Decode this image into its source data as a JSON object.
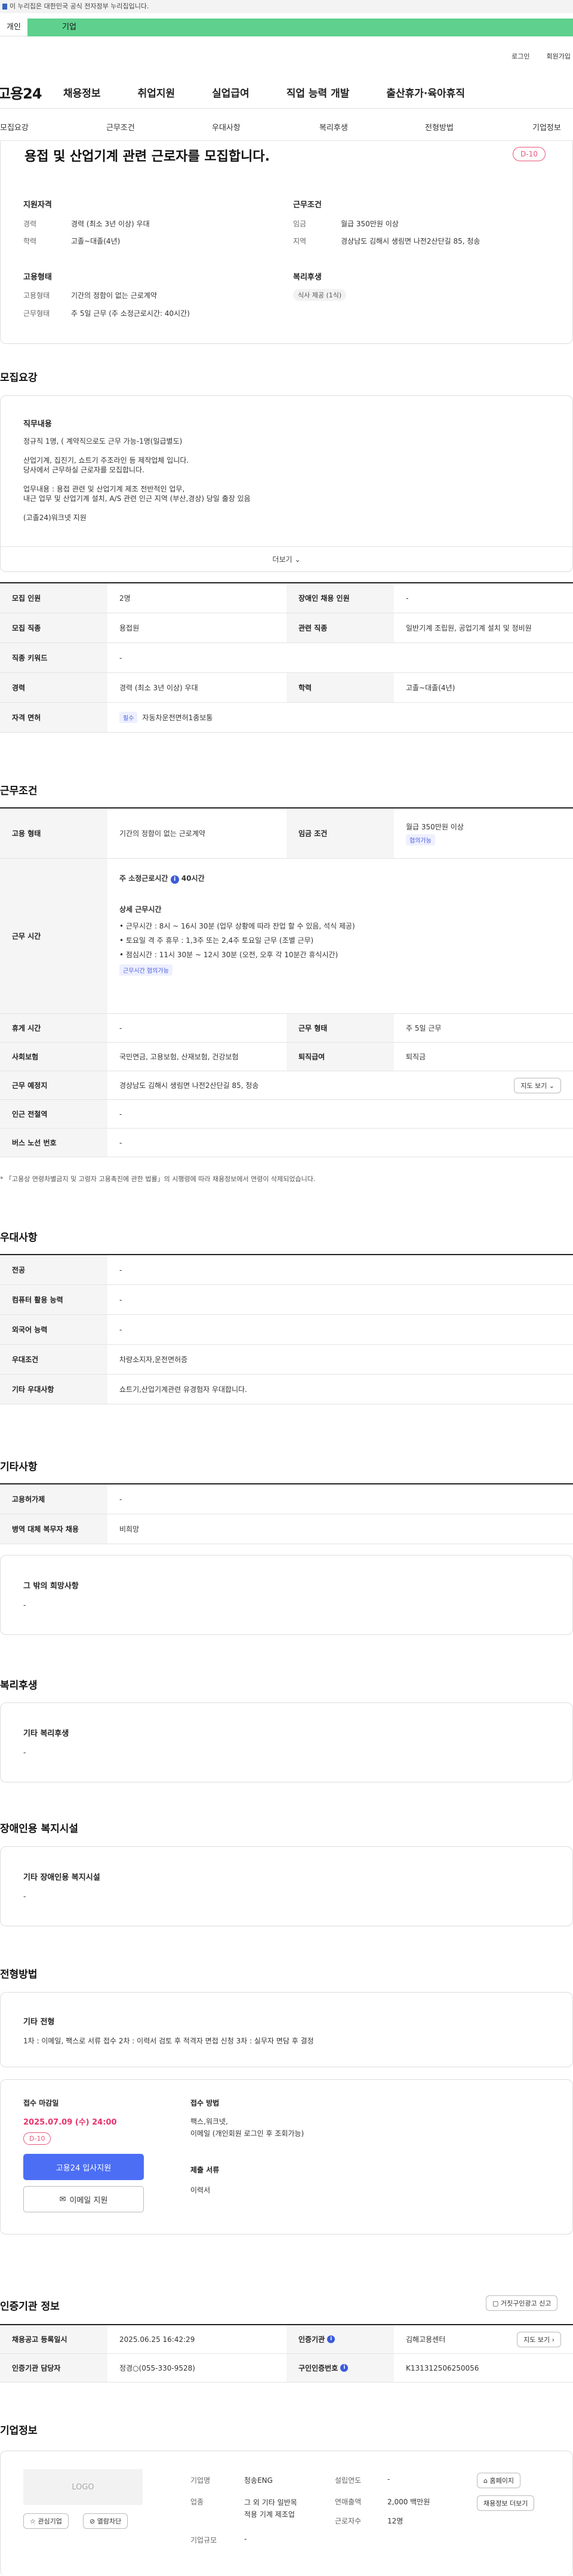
{
  "gov_bar": "이 누리집은 대한민국 공식 전자정부 누리집입니다.",
  "site_tabs": [
    "개인",
    "기업"
  ],
  "util_links": [
    "로그인",
    "회원가입"
  ],
  "logo": "고용24",
  "gnb": [
    "채용정보",
    "취업지원",
    "실업급여",
    "직업 능력 개발",
    "출산휴가·육아휴직"
  ],
  "subnav": [
    "모집요강",
    "근무조건",
    "우대사항",
    "복리후생",
    "전형방법",
    "기업정보"
  ],
  "summary": {
    "title": "용접 및 산업기계 관련 근로자를 모집합니다.",
    "dday": "D-10",
    "qual_title": "지원자격",
    "career_label": "경력",
    "career": "경력 (최소 3년 이상) 우대",
    "edu_label": "학력",
    "edu": "고졸~대졸(4년)",
    "cond_title": "근무조건",
    "wage_label": "임금",
    "wage": "월급 350만원 이상",
    "region_label": "지역",
    "region": "경상남도 김해시 생림면 나전2산단길 85, 청송",
    "emp_title": "고용형태",
    "emp_type_label": "고용형태",
    "emp_type": "기간의 정함이 없는 근로계약",
    "work_label": "근무형태",
    "work": "주 5일 근무 (주 소정근로시간: 40시간)",
    "welfare_title": "복리후생",
    "welfare_chip": "식사 제공 (1식)"
  },
  "recruit": {
    "heading": "모집요강",
    "duty_title": "직무내용",
    "duty_lines": [
      "정규직 1명, ( 계약직으로도 근무 가능-1명(일급별도)",
      "",
      "산업기계, 집진기, 쇼트기 주조라인 등 제작업체 입니다.",
      "당사에서 근무하실 근로자를 모집합니다.",
      "",
      "업무내용 : 용접 관련 및 산업기계 제조 전반적인 업무,",
      "내근 업무 및 산업기계 설치, A/S 관련 인근 지역 (부산,경상) 당일 출장 있음",
      "",
      "(고졸24)워크넷 지원"
    ],
    "more": "더보기",
    "rows": [
      [
        "모집 인원",
        "2명",
        "장애인 채용 인원",
        "-"
      ],
      [
        "모집 직종",
        "용접원",
        "관련 직종",
        "일반기계 조립원, 공업기계 설치 및 정비원"
      ],
      [
        "직종 키워드",
        "-"
      ],
      [
        "경력",
        "경력 (최소 3년 이상) 우대",
        "학력",
        "고졸~대졸(4년)"
      ]
    ],
    "license_label": "자격 면허",
    "license_badge": "필수",
    "license": "자동차운전면허1종보통"
  },
  "work": {
    "heading": "근무조건",
    "emp_label": "고용 형태",
    "emp": "기간의 정함이 없는 근로계약",
    "wage_label": "임금 조건",
    "wage": "월급 350만원 이상",
    "wage_badge": "협의가능",
    "time_label": "근무 시간",
    "weekly": "주 소정근로시간",
    "weekly_val": "40시간",
    "detail_title": "상세 근무시간",
    "detail": [
      "• 근무시간 : 8시 ~ 16시 30분 (업무 상황에 따라 잔업 할 수 있음, 석식 제공)",
      "• 토요일 격 주 휴무 : 1,3주 또는 2,4주 토요일 근무 (조별 근무)",
      "• 점심시간 : 11시 30분 ~ 12시 30분 (오전, 오후 각 10분간 휴식시간)"
    ],
    "time_badge": "근무시간 협의가능",
    "holiday_label": "휴게 시간",
    "holiday": "-",
    "type_label": "근무 형태",
    "type": "주 5일 근무",
    "ins_label": "사회보험",
    "ins": "국민연금, 고용보험, 산재보험, 건강보험",
    "ret_label": "퇴직급여",
    "ret": "퇴직금",
    "place_label": "근무 예정지",
    "place": "경상남도 김해시 생림면 나전2산단길 85, 청송",
    "map_btn": "지도 보기",
    "subway_label": "인근 전철역",
    "subway": "-",
    "bus_label": "버스 노선 번호",
    "bus": "-",
    "note": "* 「고용상 연령차별금지 및 고령자 고용촉진에 관한 법률」의 시행령에 따라 채용정보에서 연령이 삭제되었습니다."
  },
  "pref": {
    "heading": "우대사항",
    "rows": [
      [
        "전공",
        "-"
      ],
      [
        "컴퓨터 활용 능력",
        "-"
      ],
      [
        "외국어 능력",
        "-"
      ],
      [
        "우대조건",
        "차량소지자,운전면허증"
      ],
      [
        "기타 우대사항",
        "쇼트기,산업기계관련 유경험자 우대합니다."
      ]
    ]
  },
  "etc": {
    "heading": "기타사항",
    "rows": [
      [
        "고용허가제",
        "-"
      ],
      [
        "병역 대체 복무자 채용",
        "비희망"
      ]
    ],
    "box_title": "그 밖의 희망사항",
    "box_val": "-"
  },
  "benefit": {
    "heading": "복리후생",
    "box_title": "기타 복리후생",
    "box_val": "-"
  },
  "disabled": {
    "heading": "장애인용 복지시설",
    "box_title": "기타 장애인용 복지시설",
    "box_val": "-"
  },
  "process": {
    "heading": "전형방법",
    "box_title": "기타 전형",
    "box_val": "1차 : 이메일, 팩스로 서류 접수 2차 : 이력서 검토 후 적격자 면접 신청 3차 : 실무자 면담 후 결정",
    "deadline_label": "접수 마감일",
    "deadline": "2025.07.09 (수) 24:00",
    "dday": "D-10",
    "apply_btn": "고용24 입사지원",
    "email_btn": "이메일 지원",
    "method_label": "접수 방법",
    "method_lines": [
      "팩스,워크넷,",
      "이메일 (개인회원 로그인 후 조회가능)"
    ],
    "docs_label": "제출 서류",
    "docs": "이력서"
  },
  "agency": {
    "heading": "인증기관 정보",
    "report_btn": "거짓구인광고 신고",
    "reg_label": "채용공고 등록일시",
    "reg": "2025.06.25 16:42:29",
    "org_label": "인증기관",
    "org": "김해고용센터",
    "map_btn": "지도 보기",
    "mgr_label": "인증기관 담당자",
    "mgr": "정경○(055-330-9528)",
    "no_label": "구인인증번호",
    "no": "K131312506250056"
  },
  "company": {
    "heading": "기업정보",
    "logo": "LOGO",
    "fav_btn": "관심기업",
    "block_btn": "열람차단",
    "name_label": "기업명",
    "name": "청송ENG",
    "year_label": "설립연도",
    "year": "-",
    "home_btn": "홈페이지",
    "ind_label": "업종",
    "ind_lines": [
      "그 외 기타 일반목",
      "적용 기계 제조업"
    ],
    "sales_label": "연매출액",
    "sales": "2,000 백만원",
    "more_btn": "채용정보 더보기",
    "emp_label": "근로자수",
    "emp": "12명",
    "scale_label": "기업규모",
    "scale": "-"
  }
}
